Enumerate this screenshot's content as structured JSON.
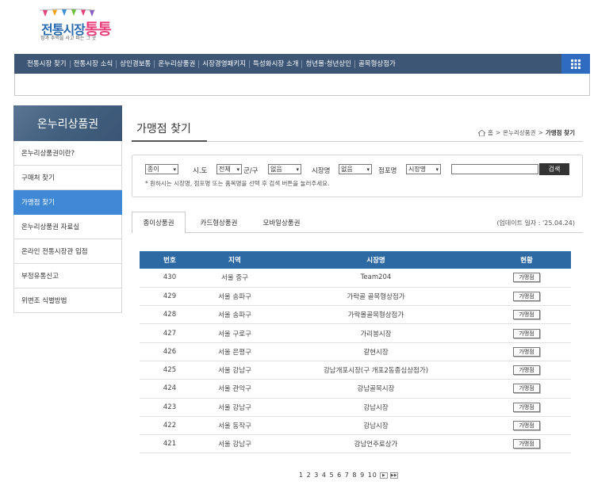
{
  "logo": {
    "main_a": "전통시장",
    "main_b": "통통",
    "subtitle": "정과 추억을 사고 파는 그 곳"
  },
  "topnav": {
    "items": [
      "전통시장 찾기",
      "전통시장 소식",
      "상인경보통",
      "온누리상품권",
      "시장경영패키지",
      "특성화시장 소개",
      "청년몰·청년상인",
      "골목형상점가"
    ]
  },
  "sidebar": {
    "title": "온누리상품권",
    "items": [
      "온누리상품권이란?",
      "구매처 찾기",
      "가맹점 찾기",
      "온누리상품권 자료실",
      "온라인 전통시장관 입점",
      "부정유통신고",
      "위변조 식별방법"
    ],
    "active_index": 2
  },
  "page": {
    "title": "가맹점 찾기"
  },
  "breadcrumb": {
    "home": "홈",
    "section": "온누리상품권",
    "current": "가맹점 찾기"
  },
  "search": {
    "type_value": "종이",
    "sido_label": "시.도",
    "sido_value": "전체",
    "gungu_label": "군/구",
    "gungu_value": "없음",
    "market_label": "시장명",
    "market_value": "없음",
    "shop_label": "점포명",
    "shop_value": "시장명",
    "query": "",
    "button": "검색",
    "hint": "* 원하시는 시장명, 점포명 또는 품목명을 선택 후 검색 버튼을 눌러주세요."
  },
  "tabs": [
    "종이상품권",
    "카드형상품권",
    "모바일상품권"
  ],
  "update": "(업데이트 일자 : '25.04.24)",
  "table": {
    "headers": [
      "번호",
      "지역",
      "시장명",
      "현황"
    ],
    "button_label": "가맹점",
    "rows": [
      [
        "430",
        "서울 중구",
        "Team204"
      ],
      [
        "429",
        "서울 송파구",
        "가락골 골목형상점가"
      ],
      [
        "428",
        "서울 송파구",
        "가락몰골목형상점가"
      ],
      [
        "427",
        "서울 구로구",
        "가리봉시장"
      ],
      [
        "426",
        "서울 은평구",
        "갈현시장"
      ],
      [
        "425",
        "서울 강남구",
        "강남개포시장(구 개포2동종심상점가)"
      ],
      [
        "424",
        "서울 관악구",
        "강남골목시장"
      ],
      [
        "423",
        "서울 강남구",
        "강남시장"
      ],
      [
        "422",
        "서울 동작구",
        "강남시장"
      ],
      [
        "421",
        "서울 강남구",
        "강남언주로상가"
      ]
    ]
  },
  "pager": {
    "pages": "1 2 3 4 5 6 7 8 9 10",
    "next": "▶",
    "last": "▶▶"
  },
  "colors": {
    "nav": "#3d5675",
    "accent": "#3f88d6",
    "table_head": "#2d6aa4"
  }
}
